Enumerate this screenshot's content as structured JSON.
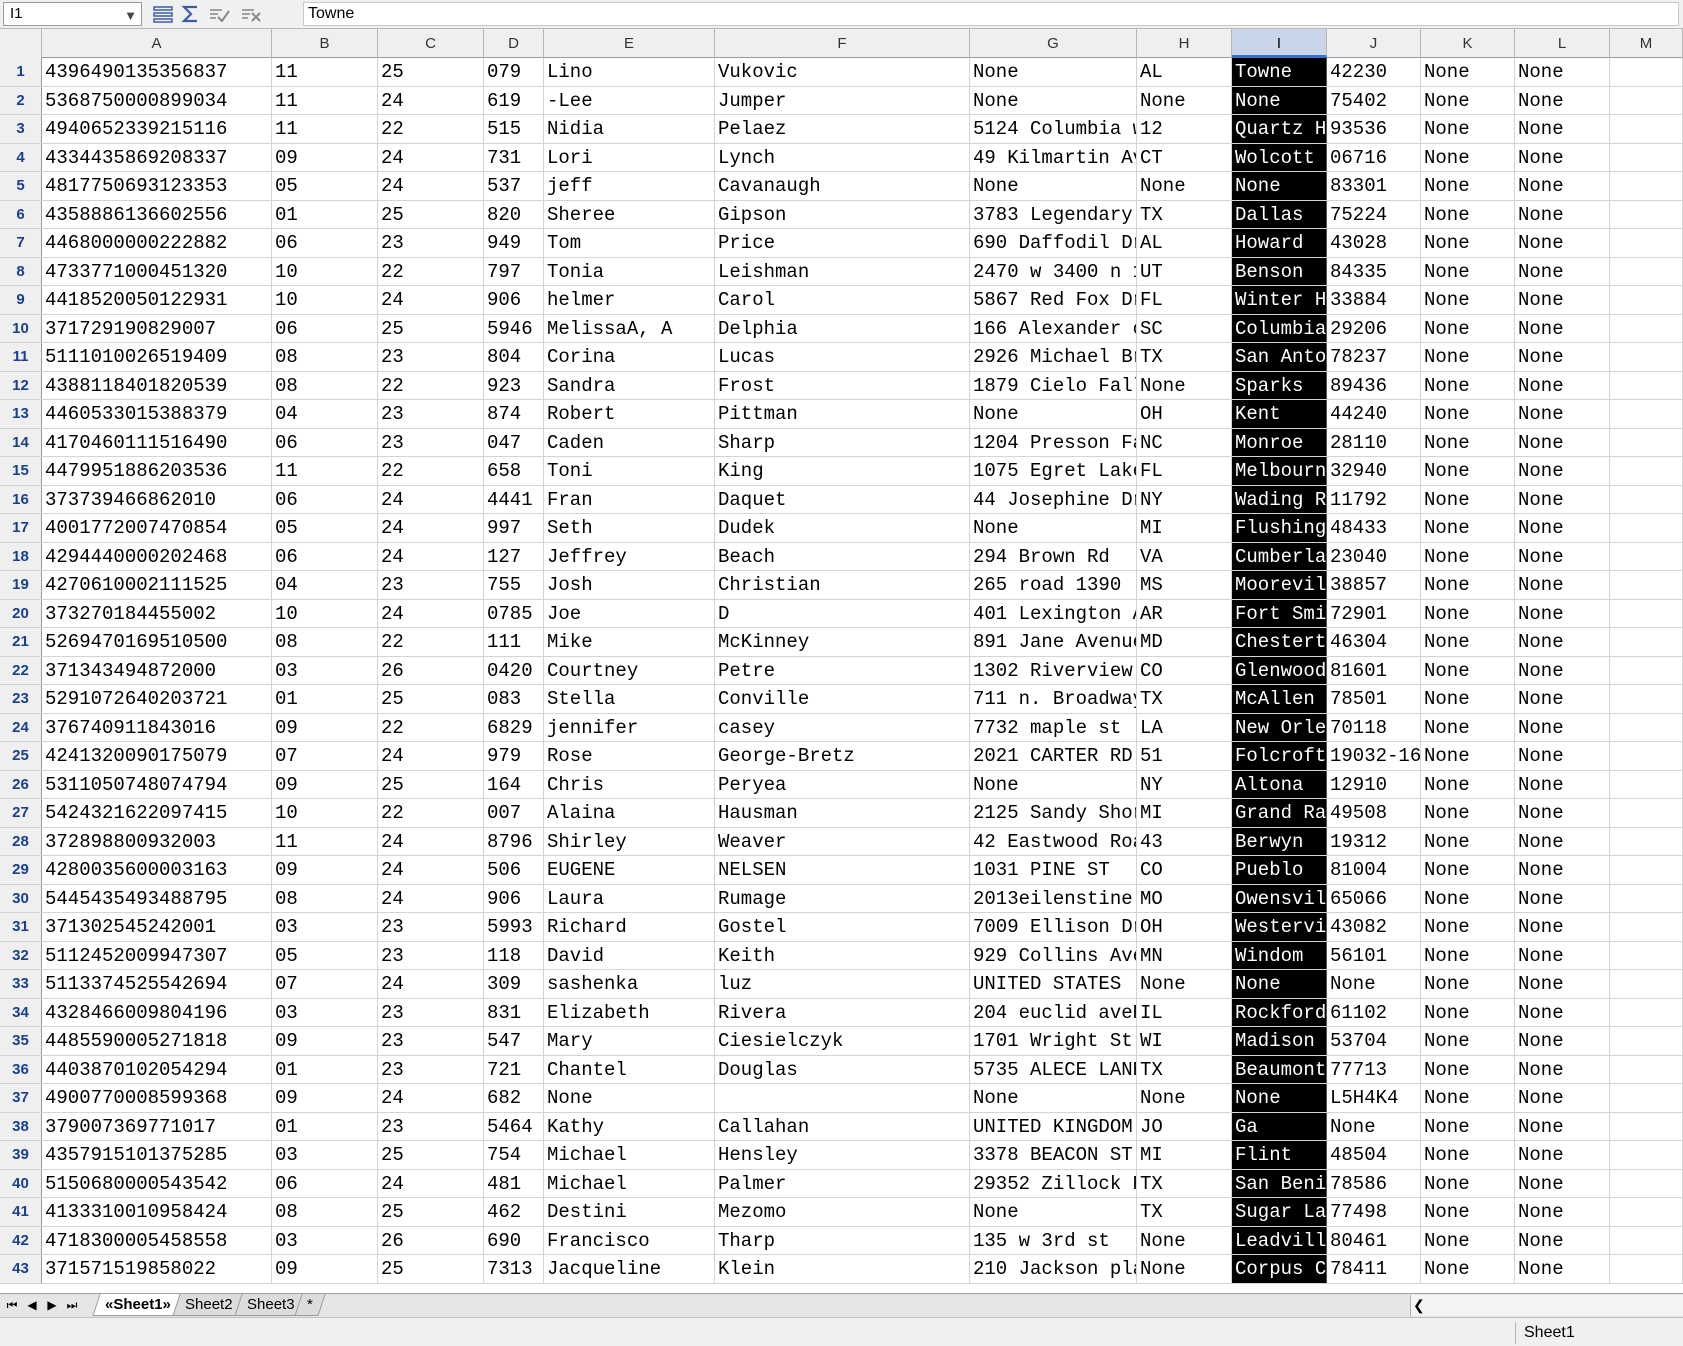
{
  "namebox": "I1",
  "formula": "Towne",
  "toolbar_icons": [
    "rows-icon",
    "sum-icon",
    "accept-icon",
    "cancel-icon"
  ],
  "columns": [
    "A",
    "B",
    "C",
    "D",
    "E",
    "F",
    "G",
    "H",
    "I",
    "J",
    "K",
    "L",
    "M"
  ],
  "selected_column": "I",
  "rows": [
    [
      "4396490135356837",
      "11",
      "25",
      "079",
      "Lino",
      "Vukovic",
      "None",
      "AL",
      "Towne",
      "42230",
      "None",
      "None"
    ],
    [
      "5368750000899034",
      "11",
      "24",
      "619",
      "-Lee",
      "Jumper",
      "None",
      "None",
      "None",
      "75402",
      "None",
      "None"
    ],
    [
      "4940652339215116",
      "11",
      "22",
      "515",
      "Nidia",
      "Pelaez",
      "5124 Columbia w",
      "12",
      "Quartz H",
      "93536",
      "None",
      "None"
    ],
    [
      "4334435869208337",
      "09",
      "24",
      "731",
      "Lori",
      "Lynch",
      "49 Kilmartin Av",
      "CT",
      "Wolcott",
      "06716",
      "None",
      "None"
    ],
    [
      "4817750693123353",
      "05",
      "24",
      "537",
      "jeff",
      "Cavanaugh",
      "None",
      "None",
      "None",
      "83301",
      "None",
      "None"
    ],
    [
      "4358886136602556",
      "01",
      "25",
      "820",
      "Sheree",
      "Gipson",
      "3783 Legendary",
      "TX",
      "Dallas",
      "75224",
      "None",
      "None"
    ],
    [
      "4468000000222882",
      "06",
      "23",
      "949",
      "Tom",
      "Price",
      "690 Daffodil Dr",
      "AL",
      "Howard",
      "43028",
      "None",
      "None"
    ],
    [
      "4733771000451320",
      "10",
      "22",
      "797",
      "Tonia",
      "Leishman",
      "2470 w 3400 n 1",
      "UT",
      "Benson",
      "84335",
      "None",
      "None"
    ],
    [
      "4418520050122931",
      "10",
      "24",
      "906",
      "helmer",
      "Carol",
      "5867 Red Fox Dr",
      "FL",
      "Winter H",
      "33884",
      "None",
      "None"
    ],
    [
      "371729190829007",
      "06",
      "25",
      "5946",
      "MelissaA, A",
      "Delphia",
      "166 Alexander c",
      "SC",
      "Columbia",
      "29206",
      "None",
      "None"
    ],
    [
      "5111010026519409",
      "08",
      "23",
      "804",
      "Corina",
      "Lucas",
      "2926 Michael Br",
      "TX",
      "San Anto",
      "78237",
      "None",
      "None"
    ],
    [
      "4388118401820539",
      "08",
      "22",
      "923",
      "Sandra",
      "Frost",
      "1879 Cielo Fall",
      "None",
      "Sparks",
      "89436",
      "None",
      "None"
    ],
    [
      "4460533015388379",
      "04",
      "23",
      "874",
      "Robert",
      "Pittman",
      "None",
      "OH",
      "Kent",
      "44240",
      "None",
      "None"
    ],
    [
      "4170460111516490",
      "06",
      "23",
      "047",
      "Caden",
      "Sharp",
      "1204 Presson Fa",
      "NC",
      "Monroe",
      "28110",
      "None",
      "None"
    ],
    [
      "4479951886203536",
      "11",
      "22",
      "658",
      "Toni",
      "King",
      "1075 Egret Lake",
      "FL",
      "Melbourn",
      "32940",
      "None",
      "None"
    ],
    [
      "373739466862010",
      "06",
      "24",
      "4441",
      "Fran",
      "Daquet",
      "44 Josephine Dr",
      "NY",
      "Wading R",
      "11792",
      "None",
      "None"
    ],
    [
      "4001772007470854",
      "05",
      "24",
      "997",
      "Seth",
      "Dudek",
      "None",
      "MI",
      "Flushing",
      "48433",
      "None",
      "None"
    ],
    [
      "4294440000202468",
      "06",
      "24",
      "127",
      "Jeffrey",
      "Beach",
      "294 Brown Rd",
      "VA",
      "Cumberla",
      "23040",
      "None",
      "None"
    ],
    [
      "4270610002111525",
      "04",
      "23",
      "755",
      "Josh",
      "Christian",
      "265 road 1390",
      "MS",
      "Moorevil",
      "38857",
      "None",
      "None"
    ],
    [
      "373270184455002",
      "10",
      "24",
      "0785",
      "Joe",
      "D",
      "401 Lexington A",
      "AR",
      "Fort Smi",
      "72901",
      "None",
      "None"
    ],
    [
      "5269470169510500",
      "08",
      "22",
      "111",
      "Mike",
      "McKinney",
      "891 Jane Avenue",
      "MD",
      "Chestert",
      "46304",
      "None",
      "None"
    ],
    [
      "371343494872000",
      "03",
      "26",
      "0420",
      "Courtney",
      "Petre",
      "1302 Riverview",
      "CO",
      "Glenwood",
      "81601",
      "None",
      "None"
    ],
    [
      "5291072640203721",
      "01",
      "25",
      "083",
      "Stella",
      "Conville",
      "711 n. Broadway",
      "TX",
      "McAllen",
      "78501",
      "None",
      "None"
    ],
    [
      "376740911843016",
      "09",
      "22",
      "6829",
      "jennifer",
      "casey",
      "7732 maple st",
      "LA",
      "New Orle",
      "70118",
      "None",
      "None"
    ],
    [
      "4241320090175079",
      "07",
      "24",
      "979",
      "Rose",
      "George-Bretz",
      "2021 CARTER RD",
      "51",
      "Folcroft",
      "19032-16",
      "None",
      "None"
    ],
    [
      "5311050748074794",
      "09",
      "25",
      "164",
      "Chris",
      "Peryea",
      "None",
      "NY",
      "Altona",
      "12910",
      "None",
      "None"
    ],
    [
      "5424321622097415",
      "10",
      "22",
      "007",
      "Alaina",
      "Hausman",
      "2125 Sandy Shor",
      "MI",
      "Grand Ra",
      "49508",
      "None",
      "None"
    ],
    [
      "372898800932003",
      "11",
      "24",
      "8796",
      "Shirley",
      "Weaver",
      "42 Eastwood Roa",
      "43",
      "Berwyn",
      "19312",
      "None",
      "None"
    ],
    [
      "4280035600003163",
      "09",
      "24",
      "506",
      "EUGENE",
      "NELSEN",
      "1031 PINE ST",
      "CO",
      "Pueblo",
      "81004",
      "None",
      "None"
    ],
    [
      "5445435493488795",
      "08",
      "24",
      "906",
      "Laura",
      "Rumage",
      "2013eilenstine",
      "MO",
      "Owensvil",
      "65066",
      "None",
      "None"
    ],
    [
      "371302545242001",
      "03",
      "23",
      "5993",
      "Richard",
      "Gostel",
      "7009 Ellison Dr",
      "OH",
      "Westervi",
      "43082",
      "None",
      "None"
    ],
    [
      "5112452009947307",
      "05",
      "23",
      "118",
      "David",
      "Keith",
      "929 Collins Ave",
      "MN",
      "Windom",
      "56101",
      "None",
      "None"
    ],
    [
      "5113374525542694",
      "07",
      "24",
      "309",
      "sashenka",
      "luz",
      "UNITED STATES",
      "None",
      "None",
      "None",
      "None",
      "None"
    ],
    [
      "4328466009804196",
      "03",
      "23",
      "831",
      "Elizabeth",
      "Rivera",
      "204 euclid aveR",
      "IL",
      "Rockford",
      "61102",
      "None",
      "None"
    ],
    [
      "4485590005271818",
      "09",
      "23",
      "547",
      "Mary",
      "Ciesielczyk",
      "1701 Wright St",
      "WI",
      "Madison",
      "53704",
      "None",
      "None"
    ],
    [
      "4403870102054294",
      "01",
      "23",
      "721",
      "Chantel",
      "Douglas",
      "5735 ALECE LANE",
      "TX",
      "Beaumont",
      "77713",
      "None",
      "None"
    ],
    [
      "4900770008599368",
      "09",
      "24",
      "682",
      "None",
      "",
      "None",
      "None",
      "None",
      "L5H4K4",
      "None",
      "None"
    ],
    [
      "379007369771017",
      "01",
      "23",
      "5464",
      "Kathy",
      "Callahan",
      "UNITED KINGDOM",
      "JO",
      "Ga",
      "None",
      "None",
      "None"
    ],
    [
      "4357915101375285",
      "03",
      "25",
      "754",
      "Michael",
      "Hensley",
      "3378 BEACON ST",
      "MI",
      "Flint",
      "48504",
      "None",
      "None"
    ],
    [
      "5150680000543542",
      "06",
      "24",
      "481",
      "Michael",
      "Palmer",
      "29352 Zillock R",
      "TX",
      "San Beni",
      "78586",
      "None",
      "None"
    ],
    [
      "4133310010958424",
      "08",
      "25",
      "462",
      "Destini",
      "Mezomo",
      "None",
      "TX",
      "Sugar La",
      "77498",
      "None",
      "None"
    ],
    [
      "4718300005458558",
      "03",
      "26",
      "690",
      "Francisco",
      "Tharp",
      "135 w 3rd st",
      "None",
      "Leadvill",
      "80461",
      "None",
      "None"
    ],
    [
      "371571519858022",
      "09",
      "25",
      "7313",
      "Jacqueline",
      "Klein",
      "210 Jackson pla",
      "None",
      "Corpus C",
      "78411",
      "None",
      "None"
    ]
  ],
  "tabs": [
    "«Sheet1»",
    "Sheet2",
    "Sheet3",
    "*"
  ],
  "status_sheet": "Sheet1"
}
